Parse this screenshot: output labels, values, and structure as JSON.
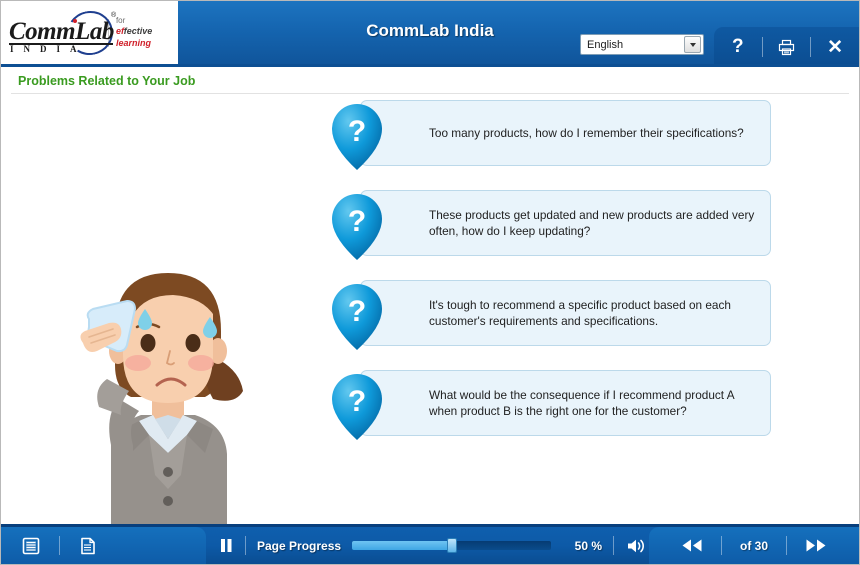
{
  "header": {
    "logo": {
      "word": "CommLab",
      "country": "INDIA",
      "registered": "®",
      "tag_line1": "for",
      "tag_ef": "ef",
      "tag_fective": "fective",
      "tag_learning": "learning"
    },
    "course_title": "CommLab India",
    "language": {
      "selected": "English",
      "options": [
        "English"
      ]
    },
    "buttons": {
      "help": "?",
      "print": "print-icon",
      "close": "✕"
    }
  },
  "subtitle": {
    "text": "Problems Related to Your Job"
  },
  "stage": {
    "character_alt": "worried-businesswoman-wiping-sweat",
    "bubbles": [
      {
        "icon": "?",
        "text": "Too many products, how do I remember their specifications?"
      },
      {
        "icon": "?",
        "text": "These products get updated and new products are added very often, how do I keep updating?"
      },
      {
        "icon": "?",
        "text": "It's tough to recommend a specific product based on each customer's requirements and specifications."
      },
      {
        "icon": "?",
        "text": "What would be the consequence if I recommend product A when product B is the right one for the customer?"
      }
    ]
  },
  "toolbar": {
    "menu_icon": "outline-list-icon",
    "notes_icon": "document-notes-icon",
    "pause_label": "pause-icon",
    "progress_label": "Page Progress",
    "progress_percent_text": "50 %",
    "progress_value": 50,
    "volume_icon": "speaker-icon",
    "prev_label": "previous-icon",
    "next_label": "next-icon",
    "page_counter": "of 30"
  },
  "colors": {
    "header_blue": "#1565b0",
    "tab_blue": "#0b4d91",
    "title_green": "#3a9b20",
    "bubble_bg": "#e9f4fb",
    "bubble_border": "#bcd9ea",
    "pin_blue": "#0b8fd4",
    "progress_fill": "#3fa6e4"
  }
}
